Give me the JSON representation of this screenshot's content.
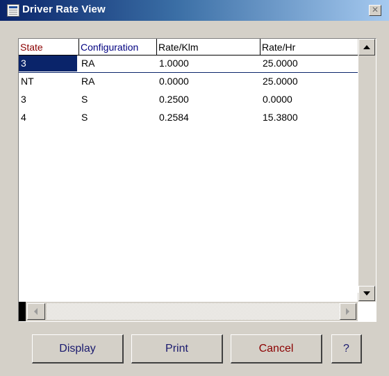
{
  "window": {
    "title": "Driver Rate View",
    "close_label": "✕"
  },
  "colors": {
    "title_bar": "#0a246a",
    "header_state": "#8b0000",
    "header_configuration": "#000080",
    "selection": "#0a246a",
    "button_display": "#1a1a6e",
    "button_cancel": "#8b0000"
  },
  "grid": {
    "columns": [
      "State",
      "Configuration",
      "Rate/Klm",
      "Rate/Hr"
    ],
    "rows": [
      {
        "state": "3",
        "configuration": "RA",
        "rate_klm": "1.0000",
        "rate_hr": "25.0000",
        "selected": true
      },
      {
        "state": "NT",
        "configuration": "RA",
        "rate_klm": "0.0000",
        "rate_hr": "25.0000"
      },
      {
        "state": "3",
        "configuration": "S",
        "rate_klm": "0.2500",
        "rate_hr": "0.0000"
      },
      {
        "state": "4",
        "configuration": "S",
        "rate_klm": "0.2584",
        "rate_hr": "15.3800"
      }
    ]
  },
  "buttons": {
    "display": "Display",
    "print": "Print",
    "cancel": "Cancel",
    "help": "?"
  }
}
